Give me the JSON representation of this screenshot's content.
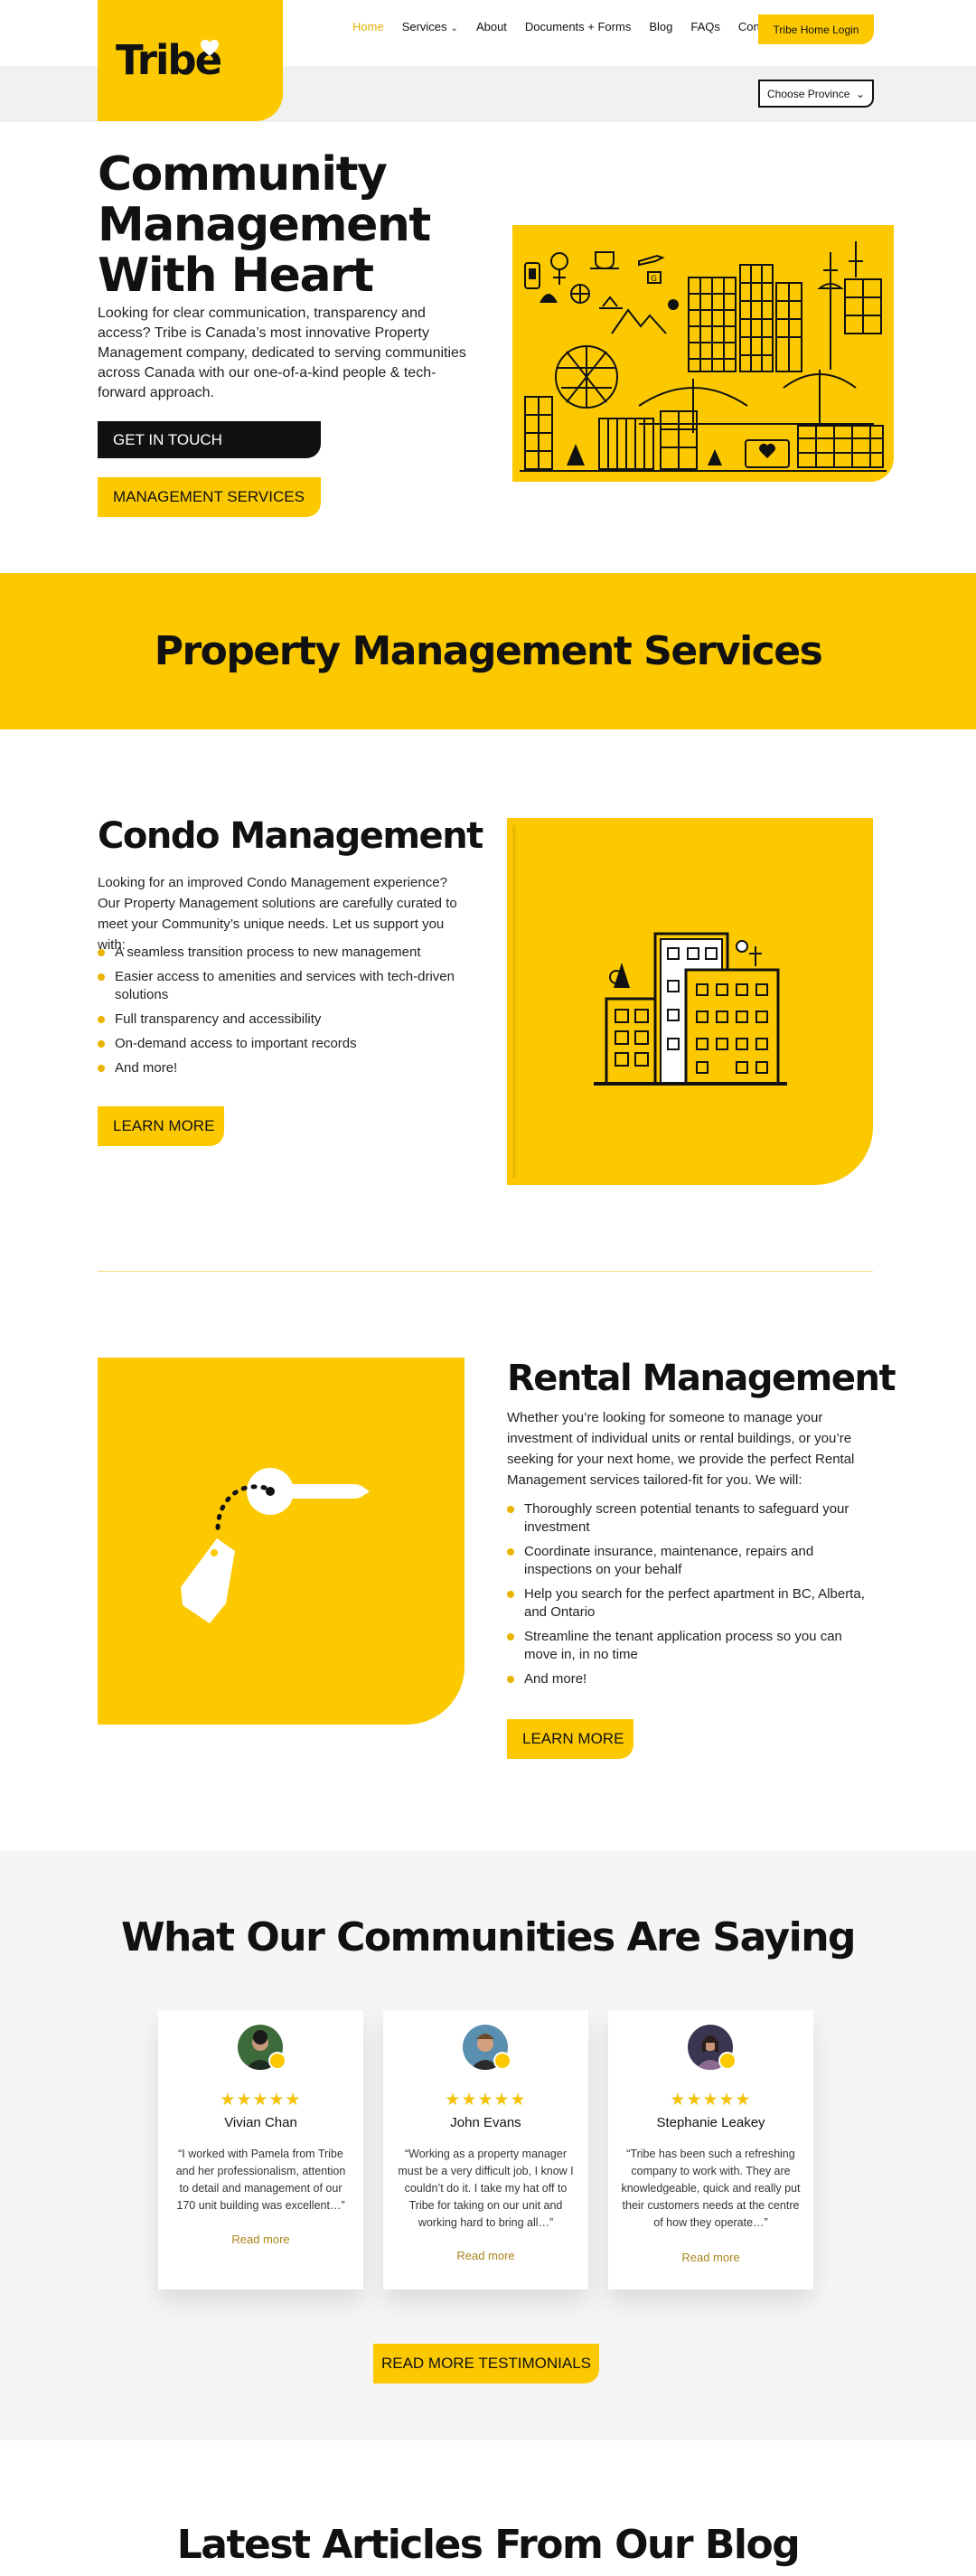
{
  "brand": {
    "name": "Tribe",
    "accent": "#fcc900",
    "dark": "#111111"
  },
  "nav": {
    "items": [
      {
        "label": "Home",
        "active": true
      },
      {
        "label": "Services",
        "has_dropdown": true
      },
      {
        "label": "About"
      },
      {
        "label": "Documents + Forms"
      },
      {
        "label": "Blog"
      },
      {
        "label": "FAQs"
      },
      {
        "label": "Contact"
      }
    ],
    "login_label": "Tribe Home Login",
    "province_select": {
      "value": "Choose Province"
    }
  },
  "hero": {
    "title": "Community Management With Heart",
    "description": "Looking for clear communication, transparency and access? Tribe is Canada’s most innovative Property Management company, dedicated to serving communities across Canada with our one-of-a-kind people & tech-forward approach.",
    "cta_primary": "GET IN TOUCH",
    "cta_secondary": "MANAGEMENT SERVICES"
  },
  "services_band": {
    "title": "Property Management Services"
  },
  "condo": {
    "title": "Condo Management",
    "description": "Looking for an improved Condo Management experience? Our Property Management solutions are carefully curated to meet your Community’s unique needs. Let us support you with:",
    "bullets": [
      "A seamless transition process to new management",
      "Easier access to amenities and services with tech-driven solutions",
      "Full transparency and accessibility",
      "On-demand access to important records",
      "And more!"
    ],
    "cta": "LEARN MORE"
  },
  "rental": {
    "title": "Rental Management",
    "description": "Whether you’re looking for someone to manage your investment of individual units or rental buildings, or you’re seeking for your next home, we provide the perfect Rental Management services tailored-fit for you. We will:",
    "bullets": [
      "Thoroughly screen potential tenants to safeguard your investment",
      "Coordinate insurance, maintenance, repairs and inspections on your behalf",
      "Help you search for the perfect apartment in BC, Alberta, and Ontario",
      "Streamline the tenant application process so you can move in, in no time",
      "And more!"
    ],
    "cta": "LEARN MORE"
  },
  "testimonials": {
    "title": "What Our Communities Are Saying",
    "items": [
      {
        "name": "Vivian Chan",
        "stars": "★★★★★",
        "quote": "“I worked with Pamela from Tribe and her professionalism, attention to detail and management of our 170 unit building was excellent…”",
        "link": "Read more"
      },
      {
        "name": "John Evans",
        "stars": "★★★★★",
        "quote": "“Working as a property manager must be a very difficult job, I know I couldn’t do it. I take my hat off to Tribe for taking on our unit and working hard to bring all…”",
        "link": "Read more"
      },
      {
        "name": "Stephanie Leakey",
        "stars": "★★★★★",
        "quote": "“Tribe has been such a refreshing company to work with. They are knowledgeable, quick and really put their customers needs at the centre of how they operate…”",
        "link": "Read more"
      }
    ],
    "cta": "READ MORE TESTIMONIALS"
  },
  "blog": {
    "title": "Latest Articles From Our Blog"
  }
}
